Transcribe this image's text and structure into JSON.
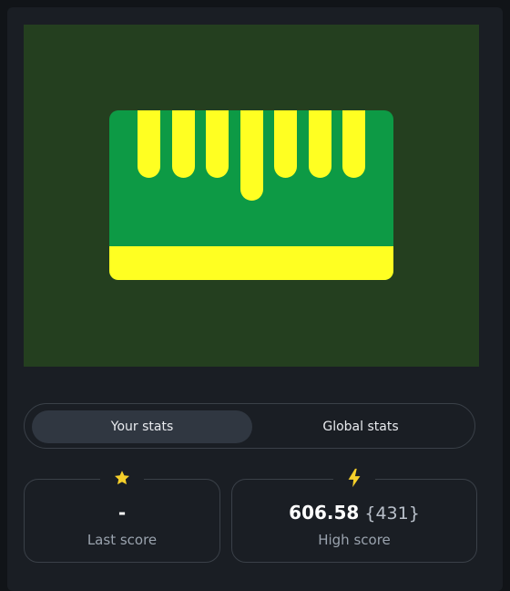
{
  "tabs": {
    "your_stats": "Your stats",
    "global_stats": "Global stats"
  },
  "stats": {
    "last_score": {
      "value": "-",
      "label": "Last score"
    },
    "high_score": {
      "value": "606.58",
      "count": "{431}",
      "label": "High score"
    }
  },
  "colors": {
    "canvas_bg": "#243f1f",
    "card_green": "#0d9a45",
    "yellow": "#ffff22",
    "star": "#f5cf2a",
    "bolt": "#f5cf2a"
  },
  "icons": {
    "last_score": "star-icon",
    "high_score": "lightning-icon"
  }
}
